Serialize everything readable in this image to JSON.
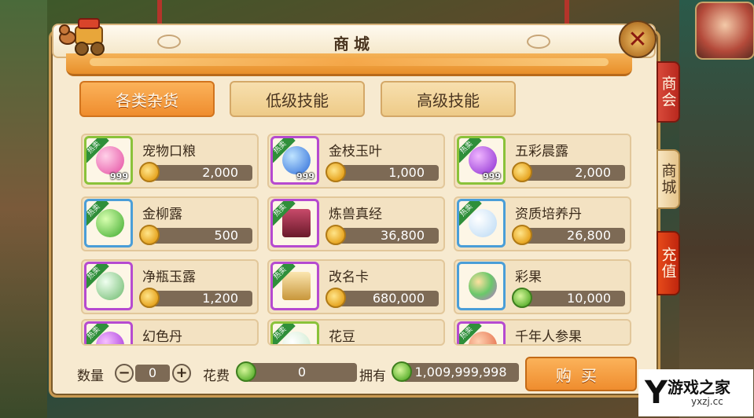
{
  "header": {
    "title": "商城"
  },
  "tabs": [
    {
      "label": "各类杂货",
      "active": true
    },
    {
      "label": "低级技能",
      "active": false
    },
    {
      "label": "高级技能",
      "active": false
    }
  ],
  "side_tabs": [
    "商会",
    "商城",
    "充值"
  ],
  "items": [
    {
      "name": "宠物口粮",
      "price": "2,000",
      "count": "999",
      "hot": true,
      "frame": "green",
      "currency": "gold",
      "icon": "pet-food-icon"
    },
    {
      "name": "金枝玉叶",
      "price": "1,000",
      "count": "999",
      "hot": true,
      "frame": "purple",
      "currency": "gold",
      "icon": "blue-vase-icon"
    },
    {
      "name": "五彩晨露",
      "price": "2,000",
      "count": "999",
      "hot": true,
      "frame": "green",
      "currency": "gold",
      "icon": "teapot-icon"
    },
    {
      "name": "金柳露",
      "price": "500",
      "count": "",
      "hot": true,
      "frame": "blue",
      "currency": "gold",
      "icon": "green-gourd-icon"
    },
    {
      "name": "炼兽真经",
      "price": "36,800",
      "count": "",
      "hot": true,
      "frame": "purple",
      "currency": "gold",
      "icon": "book-icon"
    },
    {
      "name": "资质培养丹",
      "price": "26,800",
      "count": "",
      "hot": true,
      "frame": "blue",
      "currency": "gold",
      "icon": "white-pearl-icon"
    },
    {
      "name": "净瓶玉露",
      "price": "1,200",
      "count": "",
      "hot": true,
      "frame": "purple",
      "currency": "gold",
      "icon": "jade-bottle-icon"
    },
    {
      "name": "改名卡",
      "price": "680,000",
      "count": "",
      "hot": true,
      "frame": "purple",
      "currency": "gold",
      "icon": "scroll-icon"
    },
    {
      "name": "彩果",
      "price": "10,000",
      "count": "",
      "hot": false,
      "frame": "blue",
      "currency": "green",
      "icon": "rainbow-fruit-icon"
    },
    {
      "name": "幻色丹",
      "price": "",
      "count": "",
      "hot": true,
      "frame": "purple",
      "currency": "gold",
      "icon": "purple-pill-icon"
    },
    {
      "name": "花豆",
      "price": "",
      "count": "",
      "hot": true,
      "frame": "green",
      "currency": "gold",
      "icon": "bean-icon"
    },
    {
      "name": "千年人参果",
      "price": "",
      "count": "",
      "hot": true,
      "frame": "purple",
      "currency": "gold",
      "icon": "ginseng-fruit-icon"
    }
  ],
  "hot_label": "热卖",
  "bottom": {
    "quantity_label": "数量",
    "quantity_value": "0",
    "minus": "−",
    "plus": "+",
    "cost_label": "花费",
    "cost_value": "0",
    "own_label": "拥有",
    "own_value": "1,009,999,998",
    "buy_label": "购买"
  },
  "close_glyph": "✕",
  "watermark": {
    "brand": "游戏之家",
    "url": "yxzj.cc"
  },
  "colors": {
    "accent": "#ef8d2e",
    "panel": "#f7ead0",
    "price_bar": "#7d6a55"
  }
}
